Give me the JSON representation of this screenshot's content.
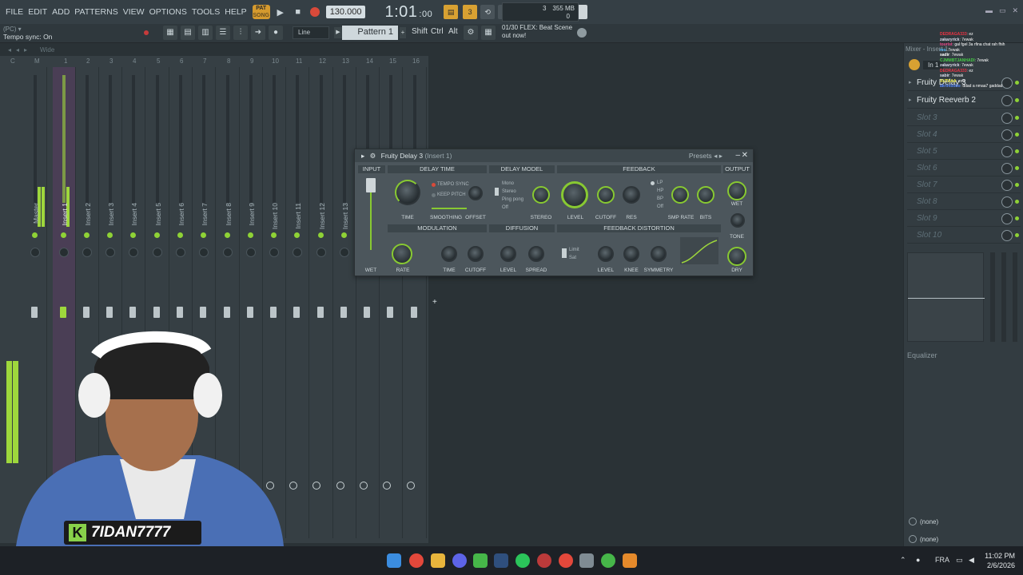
{
  "menu": [
    "FILE",
    "EDIT",
    "ADD",
    "PATTERNS",
    "VIEW",
    "OPTIONS",
    "TOOLS",
    "HELP"
  ],
  "transport": {
    "pat_label": "PAT",
    "song_label": "SONG",
    "bpm": "130.000",
    "time": "1:01",
    "time_small": ":00"
  },
  "cpu": {
    "value": "3",
    "mem": "355 MB",
    "poly": "0"
  },
  "toolbar2": {
    "hint_top": "(PC) ▾",
    "status": "Tempo sync: On",
    "line": "Line",
    "pattern": "Pattern 1",
    "shift": "Shift",
    "ctrl": "Ctrl",
    "alt": "Alt"
  },
  "news": {
    "line1": "01/30  FLEX: Beat Scene",
    "line2": "out now!"
  },
  "mixhead": {
    "label": "Wide"
  },
  "mixer": {
    "numbers": [
      "C",
      "M",
      "1",
      "2",
      "3",
      "4",
      "5",
      "6",
      "7",
      "8",
      "9",
      "10",
      "11",
      "12",
      "13",
      "14",
      "15",
      "16"
    ],
    "tracks": [
      "Master",
      "Insert 1",
      "Insert 2",
      "Insert 3",
      "Insert 4",
      "Insert 5",
      "Insert 6",
      "Insert 7",
      "Insert 8",
      "Insert 9",
      "Insert 10",
      "Insert 11",
      "Insert 12",
      "Insert 13"
    ]
  },
  "plugin": {
    "title": "Fruity Delay 3",
    "insert": "(Insert 1)",
    "presets": "Presets",
    "sections": {
      "input": "INPUT",
      "delay_time": "DELAY TIME",
      "delay_model": "DELAY MODEL",
      "feedback": "FEEDBACK",
      "output": "OUTPUT",
      "modulation": "MODULATION",
      "diffusion": "DIFFUSION",
      "feedback_distortion": "FEEDBACK DISTORTION"
    },
    "labels": {
      "time": "TIME",
      "smoothing": "SMOOTHING",
      "offset": "OFFSET",
      "stereo": "STEREO",
      "level": "LEVEL",
      "cutoff": "CUTOFF",
      "res": "RES",
      "smp_rate": "SMP RATE",
      "bits": "BITS",
      "wet_out": "WET",
      "tone": "TONE",
      "wet": "WET",
      "rate": "RATE",
      "mod_time": "TIME",
      "mod_cutoff": "CUTOFF",
      "diff_level": "LEVEL",
      "spread": "SPREAD",
      "dist_level": "LEVEL",
      "knee": "KNEE",
      "symmetry": "SYMMETRY",
      "dry": "DRY"
    },
    "tempo_sync": "TEMPO SYNC",
    "keep_pitch": "KEEP PITCH",
    "models": [
      "Mono",
      "Stereo",
      "Ping pong",
      "Off"
    ],
    "filters": [
      "LP",
      "HP",
      "BP",
      "Off"
    ],
    "dist_modes": [
      "Limit",
      "Sat"
    ]
  },
  "right_panel": {
    "header": "Mixer - Insert 1",
    "input": "In 1",
    "slots": [
      "Fruity Delay 3",
      "Fruity Reeverb 2",
      "Slot 3",
      "Slot 4",
      "Slot 5",
      "Slot 6",
      "Slot 7",
      "Slot 8",
      "Slot 9",
      "Slot 10"
    ],
    "eq_label": "Equalizer",
    "out1": "(none)",
    "out2": "(none)"
  },
  "chat": [
    {
      "user": "DEDRAGA333",
      "msg": "ez"
    },
    {
      "user": "zakaryrick",
      "msg": "7ewak"
    },
    {
      "user": "tourist",
      "msg": "gal fgel 3a rfina chat rah fhih"
    },
    {
      "user": "mo",
      "msg": "7ewak"
    },
    {
      "user": "sadir",
      "msg": "7ewak"
    },
    {
      "user": "CJMMBTJANHADI",
      "msg": "7ewak"
    },
    {
      "user": "zakaryrick",
      "msg": "7ewak"
    },
    {
      "user": "DEDRAGA333",
      "msg": "ez"
    },
    {
      "user": "sabir",
      "msg": "7ewak"
    },
    {
      "user": "XUTAAA",
      "msg": "zoo"
    },
    {
      "user": "akrimbobo",
      "msg": "ddad a nmaa7 gaddad"
    }
  ],
  "streamer": {
    "initial": "K",
    "name": "7IDAN7777"
  },
  "tray": {
    "lang": "FRA",
    "time": "11:02 PM",
    "date": "2/6/2026"
  },
  "colors": {
    "accent_green": "#8fd236",
    "orange": "#d8a132",
    "bg": "#2a3236"
  }
}
